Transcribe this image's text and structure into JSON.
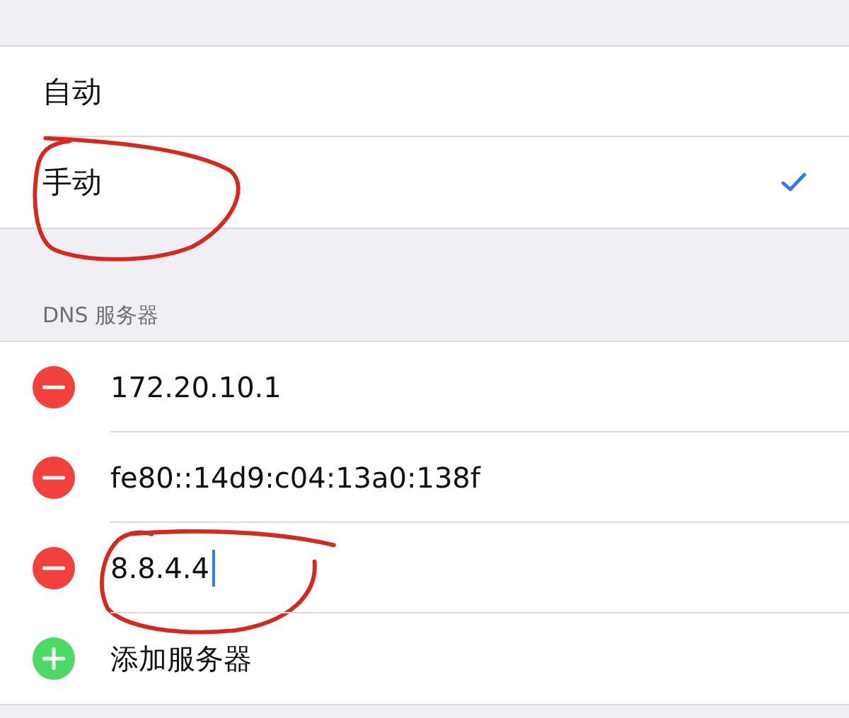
{
  "modes": [
    {
      "label": "自动",
      "selected": false,
      "circled": false
    },
    {
      "label": "手动",
      "selected": true,
      "circled": true
    }
  ],
  "dns_header": "DNS 服务器",
  "servers": [
    {
      "kind": "remove",
      "label": "172.20.10.1",
      "editing": false,
      "circled": false
    },
    {
      "kind": "remove",
      "label": "fe80::14d9:c04:13a0:138f",
      "editing": false,
      "circled": false
    },
    {
      "kind": "remove",
      "label": "8.8.4.4",
      "editing": true,
      "circled": true
    },
    {
      "kind": "add",
      "label": "添加服务器",
      "editing": false,
      "circled": false
    }
  ]
}
